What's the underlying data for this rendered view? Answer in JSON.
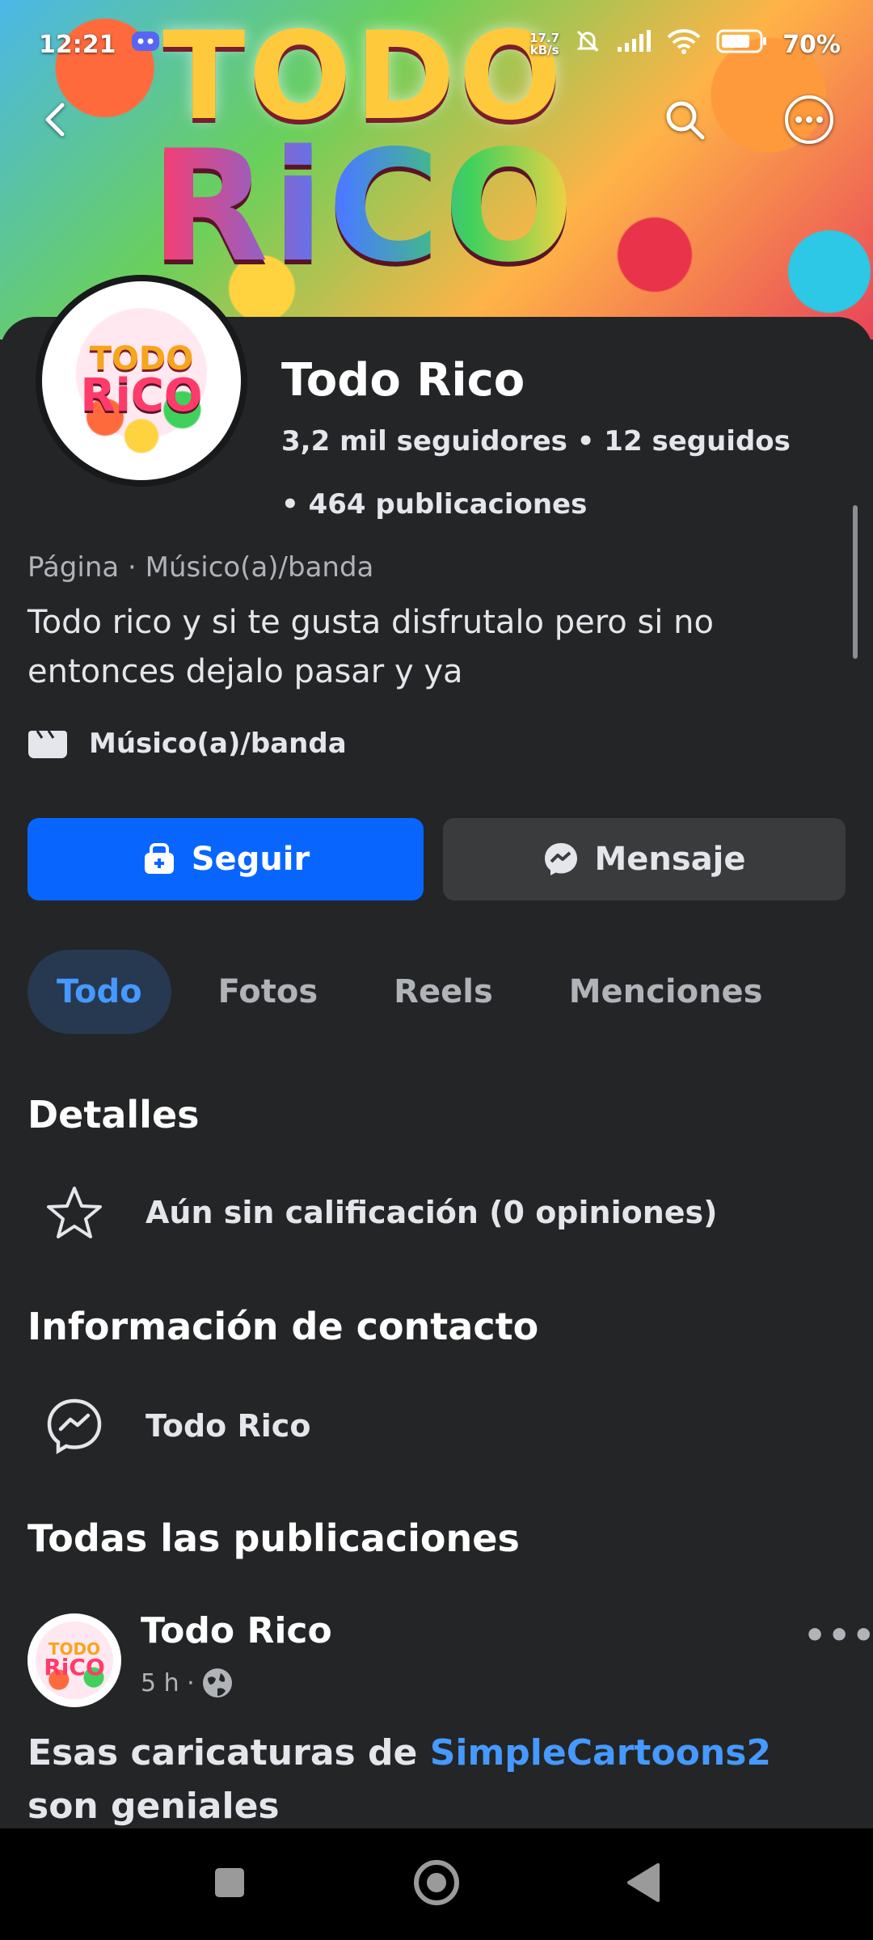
{
  "status_bar": {
    "time": "12:21",
    "network_speed_value": "17.7",
    "network_speed_unit": "kB/s",
    "battery": "70%",
    "icons": [
      "discord-icon",
      "alarm-off-icon",
      "signal-icon",
      "wifi-icon",
      "battery-icon"
    ]
  },
  "cover": {
    "logo_line1": "TODO",
    "logo_line2": "RiCO"
  },
  "avatar": {
    "logo_line1": "TODO",
    "logo_line2": "RiCO"
  },
  "profile": {
    "name": "Todo Rico",
    "stats_line1": "3,2 mil seguidores • 12 seguidos",
    "stats_line2": "• 464 publicaciones",
    "category": "Página · Músico(a)/banda",
    "bio": "Todo rico y si te gusta disfrutalo pero si no entonces dejalo pasar y ya",
    "info_category": "Músico(a)/banda"
  },
  "actions": {
    "follow_label": "Seguir",
    "message_label": "Mensaje",
    "accent_color": "#0866ff"
  },
  "tabs": [
    {
      "label": "Todo",
      "active": true
    },
    {
      "label": "Fotos",
      "active": false
    },
    {
      "label": "Reels",
      "active": false
    },
    {
      "label": "Menciones",
      "active": false
    }
  ],
  "details": {
    "heading": "Detalles",
    "rating_text": "Aún sin calificación (0 opiniones)"
  },
  "contact": {
    "heading": "Información de contacto",
    "messenger_name": "Todo Rico"
  },
  "posts": {
    "heading": "Todas las publicaciones",
    "items": [
      {
        "author": "Todo Rico",
        "avatar_line1": "TODO",
        "avatar_line2": "RiCO",
        "time": "5 h ·",
        "text_before": "Esas caricaturas de ",
        "mention": "SimpleCartoons2",
        "text_after": " son geniales"
      }
    ]
  }
}
